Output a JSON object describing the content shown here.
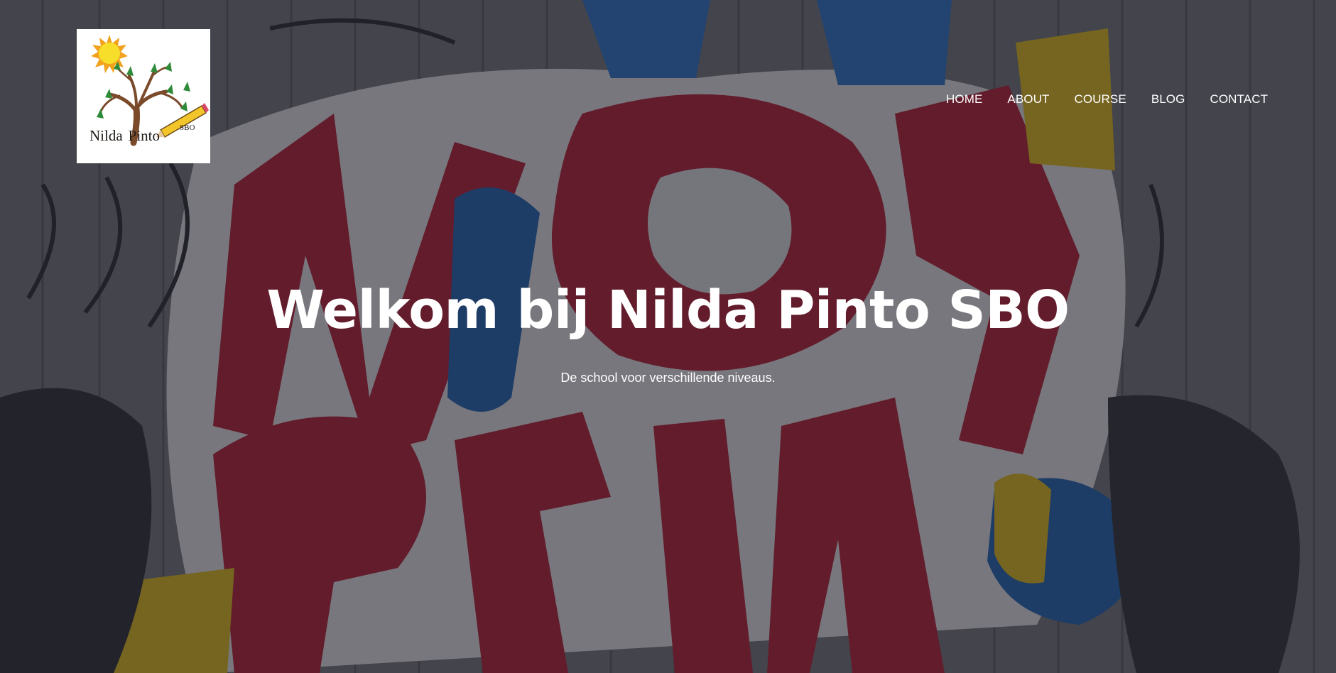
{
  "logo": {
    "name_first": "Nilda",
    "name_last": "Pinto",
    "suffix": "SBO",
    "icons": [
      "sun-icon",
      "tree-icon",
      "pencil-icon"
    ]
  },
  "nav": {
    "items": [
      {
        "label": "HOME"
      },
      {
        "label": "ABOUT"
      },
      {
        "label": "COURSE"
      },
      {
        "label": "BLOG"
      },
      {
        "label": "CONTACT"
      }
    ]
  },
  "hero": {
    "title": "Welkom bij Nilda Pinto SBO",
    "subtitle": "De school voor verschillende niveaus."
  },
  "colors": {
    "overlay": "#1c1c24",
    "text": "#ffffff",
    "graffiti_red": "#c8203a",
    "graffiti_blue": "#1e6fc8",
    "graffiti_yellow": "#e6c21e",
    "graffiti_white": "#e8e8ea"
  }
}
